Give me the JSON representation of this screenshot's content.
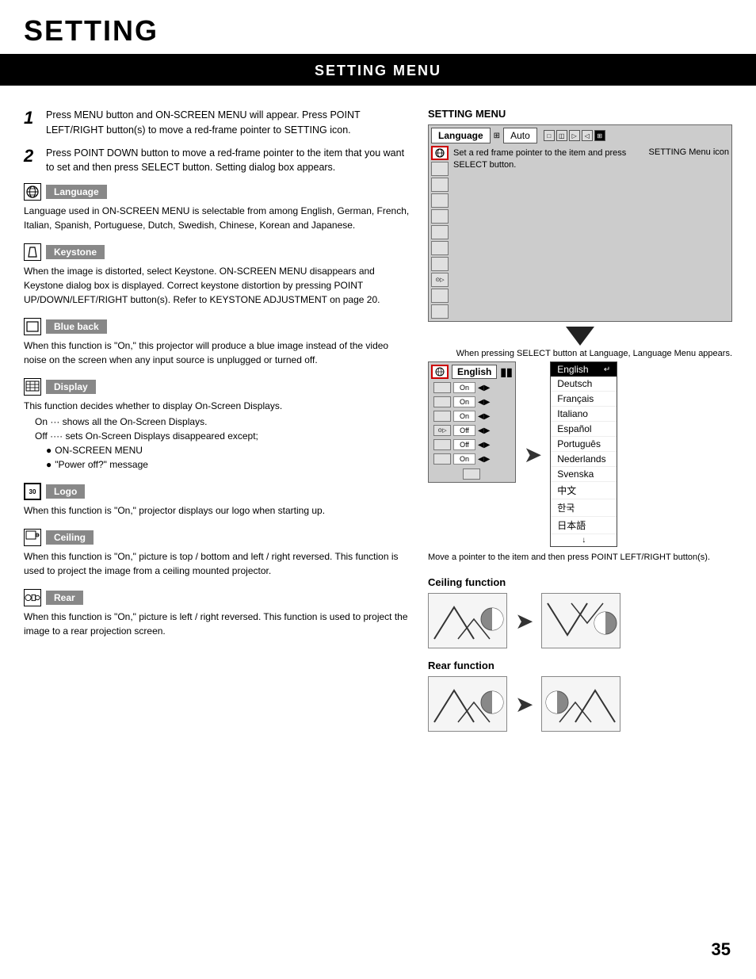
{
  "page": {
    "title": "SETTING",
    "section_title": "SETTING MENU",
    "page_number": "35"
  },
  "steps": [
    {
      "num": "1",
      "text": "Press MENU button and ON-SCREEN MENU will appear.  Press POINT LEFT/RIGHT button(s) to move a red-frame pointer to SETTING icon."
    },
    {
      "num": "2",
      "text": "Press POINT DOWN button to move a red-frame pointer to the item that you want to set and then press SELECT button. Setting dialog box appears."
    }
  ],
  "features": [
    {
      "id": "language",
      "icon_text": "⊕",
      "name": "Language",
      "desc": "Language used in ON-SCREEN MENU is selectable from among English, German, French, Italian, Spanish, Portuguese, Dutch, Swedish, Chinese, Korean and Japanese."
    },
    {
      "id": "keystone",
      "icon_text": "▽",
      "name": "Keystone",
      "desc": "When the image is distorted, select Keystone.  ON-SCREEN MENU disappears and Keystone dialog box is displayed.  Correct keystone distortion by pressing POINT UP/DOWN/LEFT/RIGHT button(s). Refer to KEYSTONE ADJUSTMENT on page 20."
    },
    {
      "id": "blue_back",
      "icon_text": "□",
      "name": "Blue back",
      "desc": "When this function is \"On,\" this projector will produce a blue image instead of the video noise on the screen when any input source is unplugged or turned off."
    },
    {
      "id": "display",
      "icon_text": "▦",
      "name": "Display",
      "desc": "This function decides whether to display On-Screen Displays.",
      "sub_items": [
        "On  ···  shows all the On-Screen Displays.",
        "Off ····  sets On-Screen Displays disappeared except;",
        "• ON-SCREEN MENU",
        "• \"Power off?\" message"
      ]
    },
    {
      "id": "logo",
      "icon_text": "30",
      "name": "Logo",
      "desc": "When this function is \"On,\" projector displays our logo when starting up."
    },
    {
      "id": "ceiling",
      "icon_text": "⌐",
      "name": "Ceiling",
      "desc": "When this function is \"On,\" picture is top / bottom and left / right reversed.  This function is used to project the image from a ceiling mounted projector."
    },
    {
      "id": "rear",
      "icon_text": "⊙",
      "name": "Rear",
      "desc": "When this function is \"On,\" picture is left / right reversed.  This function is used to project the image to a rear projection screen."
    }
  ],
  "right_panel": {
    "title": "SETTING MENU",
    "menu_bar": {
      "lang_tab": "Language",
      "auto_tab": "Auto"
    },
    "callout_1": {
      "text": "Set a red frame pointer to the item and press SELECT button."
    },
    "callout_2": "SETTING Menu icon",
    "annotation_1": "When pressing SELECT button at Language, Language Menu appears.",
    "annotation_2": "Move a pointer to the item and then press POINT LEFT/RIGHT button(s).",
    "english_label": "English",
    "language_list": [
      {
        "lang": "English",
        "selected": true
      },
      {
        "lang": "Deutsch",
        "selected": false
      },
      {
        "lang": "Français",
        "selected": false
      },
      {
        "lang": "Italiano",
        "selected": false
      },
      {
        "lang": "Español",
        "selected": false
      },
      {
        "lang": "Português",
        "selected": false
      },
      {
        "lang": "Nederlands",
        "selected": false
      },
      {
        "lang": "Svenska",
        "selected": false
      },
      {
        "lang": "中文",
        "selected": false
      },
      {
        "lang": "한국",
        "selected": false
      },
      {
        "lang": "日本語",
        "selected": false
      }
    ],
    "screen_rows": [
      {
        "label": "On",
        "has_arrow": true
      },
      {
        "label": "On",
        "has_arrow": true
      },
      {
        "label": "On",
        "has_arrow": true
      },
      {
        "label": "Off",
        "has_arrow": true
      },
      {
        "label": "Off",
        "has_arrow": true
      },
      {
        "label": "On",
        "has_arrow": true
      }
    ]
  },
  "ceiling_section": {
    "title": "Ceiling function",
    "rear_title": "Rear function"
  }
}
